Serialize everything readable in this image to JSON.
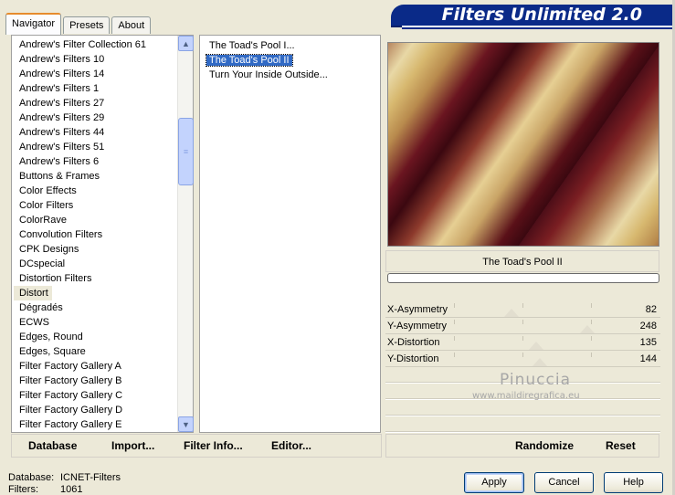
{
  "tabs": [
    "Navigator",
    "Presets",
    "About"
  ],
  "banner_title": "Filters Unlimited 2.0",
  "categories": [
    "Andrew's Filter Collection 61",
    "Andrew's Filters 10",
    "Andrew's Filters 14",
    "Andrew's Filters 1",
    "Andrew's Filters 27",
    "Andrew's Filters 29",
    "Andrew's Filters 44",
    "Andrew's Filters 51",
    "Andrew's Filters 6",
    "Buttons & Frames",
    "Color Effects",
    "Color Filters",
    "ColorRave",
    "Convolution Filters",
    "CPK Designs",
    "DCspecial",
    "Distortion Filters",
    "Distort",
    "Dégradés",
    "ECWS",
    "Edges, Round",
    "Edges, Square",
    "Filter Factory Gallery A",
    "Filter Factory Gallery B",
    "Filter Factory Gallery C",
    "Filter Factory Gallery D",
    "Filter Factory Gallery E"
  ],
  "selected_category": "Distort",
  "filters": [
    "The Toad's Pool I...",
    "The Toad's Pool II",
    "Turn Your Inside Outside..."
  ],
  "selected_filter": "The Toad's Pool II",
  "filter_name": "The Toad's Pool II",
  "params": [
    {
      "label": "X-Asymmetry",
      "value": "82",
      "level": 82
    },
    {
      "label": "Y-Asymmetry",
      "value": "248",
      "level": 248
    },
    {
      "label": "X-Distortion",
      "value": "135",
      "level": 135
    },
    {
      "label": "Y-Distortion",
      "value": "144",
      "level": 144
    }
  ],
  "param_max": 255,
  "watermark": {
    "name": "Pinuccia",
    "url": "www.maildiregrafica.eu"
  },
  "bottom_links": {
    "database": "Database",
    "import": "Import...",
    "filter_info": "Filter Info...",
    "editor": "Editor...",
    "randomize": "Randomize",
    "reset": "Reset"
  },
  "status": {
    "database_label": "Database:",
    "database_value": "ICNET-Filters",
    "filters_label": "Filters:",
    "filters_value": "1061"
  },
  "buttons": {
    "apply": "Apply",
    "cancel": "Cancel",
    "help": "Help"
  }
}
